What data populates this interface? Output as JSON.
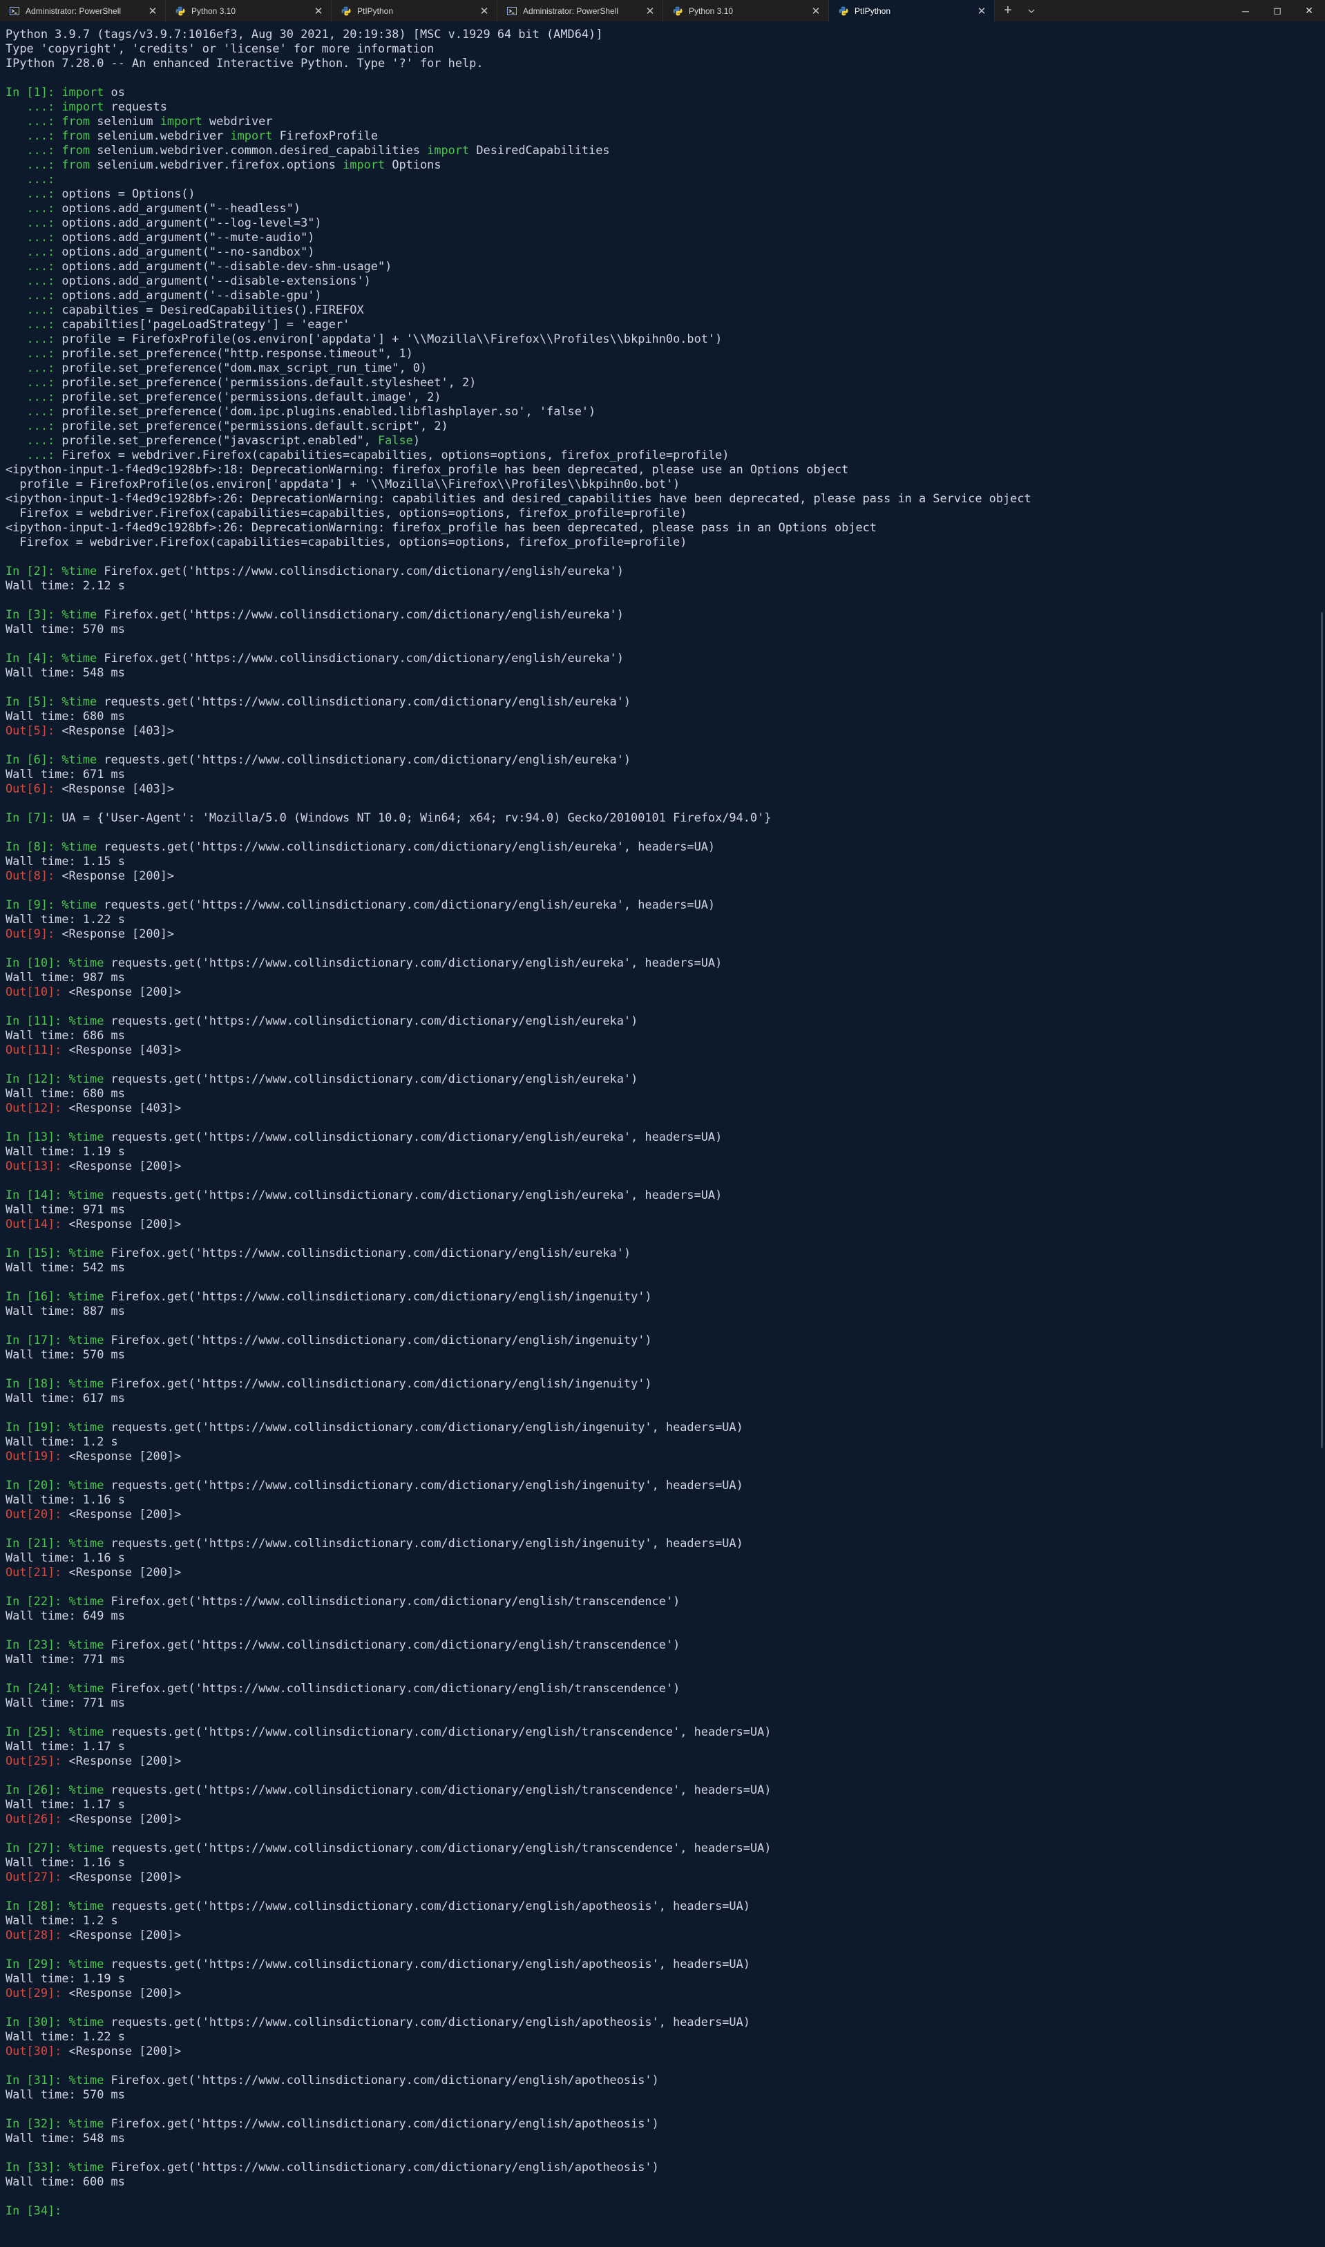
{
  "tabs": [
    {
      "label": "Administrator: PowerShell",
      "icon": "powershell-icon",
      "active": false
    },
    {
      "label": "Python 3.10",
      "icon": "python-icon",
      "active": false
    },
    {
      "label": "PtIPython",
      "icon": "python-icon",
      "active": false
    },
    {
      "label": "Administrator: PowerShell",
      "icon": "powershell-icon",
      "active": false
    },
    {
      "label": "Python 3.10",
      "icon": "python-icon",
      "active": false
    },
    {
      "label": "PtIPython",
      "icon": "python-icon",
      "active": true
    }
  ],
  "tab_controls": {
    "close": "✕",
    "new_tab": "+",
    "dropdown": "chevron-down-icon"
  },
  "window_controls": {
    "minimize": "─",
    "maximize": "◻",
    "close": "✕"
  },
  "colors": {
    "background": "#0c1a2c",
    "text": "#cfd6e0",
    "prompt_in": "#4ec44e",
    "prompt_out": "#d8483f",
    "keyword": "#4ec44e"
  },
  "lines": [
    {
      "text": "Python 3.9.7 (tags/v3.9.7:1016ef3, Aug 30 2021, 20:19:38) [MSC v.1929 64 bit (AMD64)]"
    },
    {
      "text": "Type 'copyright', 'credits' or 'license' for more information"
    },
    {
      "text": "IPython 7.28.0 -- An enhanced Interactive Python. Type '?' for help."
    },
    {
      "text": ""
    },
    {
      "prompt": "In [1]: ",
      "kw": "import",
      "text": " os"
    },
    {
      "cont": "   ...: ",
      "kw": "import",
      "text": " requests"
    },
    {
      "cont": "   ...: ",
      "kw": "from",
      "text": " selenium ",
      "kw2": "import",
      "text2": " webdriver"
    },
    {
      "cont": "   ...: ",
      "kw": "from",
      "text": " selenium.webdriver ",
      "kw2": "import",
      "text2": " FirefoxProfile"
    },
    {
      "cont": "   ...: ",
      "kw": "from",
      "text": " selenium.webdriver.common.desired_capabilities ",
      "kw2": "import",
      "text2": " DesiredCapabilities"
    },
    {
      "cont": "   ...: ",
      "kw": "from",
      "text": " selenium.webdriver.firefox.options ",
      "kw2": "import",
      "text2": " Options"
    },
    {
      "cont": "   ...:",
      "text": ""
    },
    {
      "cont": "   ...: ",
      "text": "options = Options()"
    },
    {
      "cont": "   ...: ",
      "text": "options.add_argument(\"--headless\")"
    },
    {
      "cont": "   ...: ",
      "text": "options.add_argument(\"--log-level=3\")"
    },
    {
      "cont": "   ...: ",
      "text": "options.add_argument(\"--mute-audio\")"
    },
    {
      "cont": "   ...: ",
      "text": "options.add_argument(\"--no-sandbox\")"
    },
    {
      "cont": "   ...: ",
      "text": "options.add_argument(\"--disable-dev-shm-usage\")"
    },
    {
      "cont": "   ...: ",
      "text": "options.add_argument('--disable-extensions')"
    },
    {
      "cont": "   ...: ",
      "text": "options.add_argument('--disable-gpu')"
    },
    {
      "cont": "   ...: ",
      "text": "capabilties = DesiredCapabilities().FIREFOX"
    },
    {
      "cont": "   ...: ",
      "text": "capabilties['pageLoadStrategy'] = 'eager'"
    },
    {
      "cont": "   ...: ",
      "text": "profile = FirefoxProfile(os.environ['appdata'] + '\\\\Mozilla\\\\Firefox\\\\Profiles\\\\bkpihn0o.bot')"
    },
    {
      "cont": "   ...: ",
      "text": "profile.set_preference(\"http.response.timeout\", 1)"
    },
    {
      "cont": "   ...: ",
      "text": "profile.set_preference(\"dom.max_script_run_time\", 0)"
    },
    {
      "cont": "   ...: ",
      "text": "profile.set_preference('permissions.default.stylesheet', 2)"
    },
    {
      "cont": "   ...: ",
      "text": "profile.set_preference('permissions.default.image', 2)"
    },
    {
      "cont": "   ...: ",
      "text": "profile.set_preference('dom.ipc.plugins.enabled.libflashplayer.so', 'false')"
    },
    {
      "cont": "   ...: ",
      "text": "profile.set_preference(\"permissions.default.script\", 2)"
    },
    {
      "cont": "   ...: ",
      "text": "profile.set_preference(\"javascript.enabled\", ",
      "kw2": "False",
      "text2": ")"
    },
    {
      "cont": "   ...: ",
      "text": "Firefox = webdriver.Firefox(capabilities=capabilties, options=options, firefox_profile=profile)"
    },
    {
      "text": "<ipython-input-1-f4ed9c1928bf>:18: DeprecationWarning: firefox_profile has been deprecated, please use an Options object"
    },
    {
      "text": "  profile = FirefoxProfile(os.environ['appdata'] + '\\\\Mozilla\\\\Firefox\\\\Profiles\\\\bkpihn0o.bot')"
    },
    {
      "text": "<ipython-input-1-f4ed9c1928bf>:26: DeprecationWarning: capabilities and desired_capabilities have been deprecated, please pass in a Service object"
    },
    {
      "text": "  Firefox = webdriver.Firefox(capabilities=capabilties, options=options, firefox_profile=profile)"
    },
    {
      "text": "<ipython-input-1-f4ed9c1928bf>:26: DeprecationWarning: firefox_profile has been deprecated, please pass in an Options object"
    },
    {
      "text": "  Firefox = webdriver.Firefox(capabilities=capabilties, options=options, firefox_profile=profile)"
    },
    {
      "text": ""
    },
    {
      "prompt": "In [2]: ",
      "kw": "%time",
      "text": " Firefox.get('https://www.collinsdictionary.com/dictionary/english/eureka')"
    },
    {
      "text": "Wall time: 2.12 s"
    },
    {
      "text": ""
    },
    {
      "prompt": "In [3]: ",
      "kw": "%time",
      "text": " Firefox.get('https://www.collinsdictionary.com/dictionary/english/eureka')"
    },
    {
      "text": "Wall time: 570 ms"
    },
    {
      "text": ""
    },
    {
      "prompt": "In [4]: ",
      "kw": "%time",
      "text": " Firefox.get('https://www.collinsdictionary.com/dictionary/english/eureka')"
    },
    {
      "text": "Wall time: 548 ms"
    },
    {
      "text": ""
    },
    {
      "prompt": "In [5]: ",
      "kw": "%time",
      "text": " requests.get('https://www.collinsdictionary.com/dictionary/english/eureka')"
    },
    {
      "text": "Wall time: 680 ms"
    },
    {
      "out": "Out[5]: ",
      "text": "<Response [403]>"
    },
    {
      "text": ""
    },
    {
      "prompt": "In [6]: ",
      "kw": "%time",
      "text": " requests.get('https://www.collinsdictionary.com/dictionary/english/eureka')"
    },
    {
      "text": "Wall time: 671 ms"
    },
    {
      "out": "Out[6]: ",
      "text": "<Response [403]>"
    },
    {
      "text": ""
    },
    {
      "prompt": "In [7]: ",
      "text": "UA = {'User-Agent': 'Mozilla/5.0 (Windows NT 10.0; Win64; x64; rv:94.0) Gecko/20100101 Firefox/94.0'}"
    },
    {
      "text": ""
    },
    {
      "prompt": "In [8]: ",
      "kw": "%time",
      "text": " requests.get('https://www.collinsdictionary.com/dictionary/english/eureka', headers=UA)"
    },
    {
      "text": "Wall time: 1.15 s"
    },
    {
      "out": "Out[8]: ",
      "text": "<Response [200]>"
    },
    {
      "text": ""
    },
    {
      "prompt": "In [9]: ",
      "kw": "%time",
      "text": " requests.get('https://www.collinsdictionary.com/dictionary/english/eureka', headers=UA)"
    },
    {
      "text": "Wall time: 1.22 s"
    },
    {
      "out": "Out[9]: ",
      "text": "<Response [200]>"
    },
    {
      "text": ""
    },
    {
      "prompt": "In [10]: ",
      "kw": "%time",
      "text": " requests.get('https://www.collinsdictionary.com/dictionary/english/eureka', headers=UA)"
    },
    {
      "text": "Wall time: 987 ms"
    },
    {
      "out": "Out[10]: ",
      "text": "<Response [200]>"
    },
    {
      "text": ""
    },
    {
      "prompt": "In [11]: ",
      "kw": "%time",
      "text": " requests.get('https://www.collinsdictionary.com/dictionary/english/eureka')"
    },
    {
      "text": "Wall time: 686 ms"
    },
    {
      "out": "Out[11]: ",
      "text": "<Response [403]>"
    },
    {
      "text": ""
    },
    {
      "prompt": "In [12]: ",
      "kw": "%time",
      "text": " requests.get('https://www.collinsdictionary.com/dictionary/english/eureka')"
    },
    {
      "text": "Wall time: 680 ms"
    },
    {
      "out": "Out[12]: ",
      "text": "<Response [403]>"
    },
    {
      "text": ""
    },
    {
      "prompt": "In [13]: ",
      "kw": "%time",
      "text": " requests.get('https://www.collinsdictionary.com/dictionary/english/eureka', headers=UA)"
    },
    {
      "text": "Wall time: 1.19 s"
    },
    {
      "out": "Out[13]: ",
      "text": "<Response [200]>"
    },
    {
      "text": ""
    },
    {
      "prompt": "In [14]: ",
      "kw": "%time",
      "text": " requests.get('https://www.collinsdictionary.com/dictionary/english/eureka', headers=UA)"
    },
    {
      "text": "Wall time: 971 ms"
    },
    {
      "out": "Out[14]: ",
      "text": "<Response [200]>"
    },
    {
      "text": ""
    },
    {
      "prompt": "In [15]: ",
      "kw": "%time",
      "text": " Firefox.get('https://www.collinsdictionary.com/dictionary/english/eureka')"
    },
    {
      "text": "Wall time: 542 ms"
    },
    {
      "text": ""
    },
    {
      "prompt": "In [16]: ",
      "kw": "%time",
      "text": " Firefox.get('https://www.collinsdictionary.com/dictionary/english/ingenuity')"
    },
    {
      "text": "Wall time: 887 ms"
    },
    {
      "text": ""
    },
    {
      "prompt": "In [17]: ",
      "kw": "%time",
      "text": " Firefox.get('https://www.collinsdictionary.com/dictionary/english/ingenuity')"
    },
    {
      "text": "Wall time: 570 ms"
    },
    {
      "text": ""
    },
    {
      "prompt": "In [18]: ",
      "kw": "%time",
      "text": " Firefox.get('https://www.collinsdictionary.com/dictionary/english/ingenuity')"
    },
    {
      "text": "Wall time: 617 ms"
    },
    {
      "text": ""
    },
    {
      "prompt": "In [19]: ",
      "kw": "%time",
      "text": " requests.get('https://www.collinsdictionary.com/dictionary/english/ingenuity', headers=UA)"
    },
    {
      "text": "Wall time: 1.2 s"
    },
    {
      "out": "Out[19]: ",
      "text": "<Response [200]>"
    },
    {
      "text": ""
    },
    {
      "prompt": "In [20]: ",
      "kw": "%time",
      "text": " requests.get('https://www.collinsdictionary.com/dictionary/english/ingenuity', headers=UA)"
    },
    {
      "text": "Wall time: 1.16 s"
    },
    {
      "out": "Out[20]: ",
      "text": "<Response [200]>"
    },
    {
      "text": ""
    },
    {
      "prompt": "In [21]: ",
      "kw": "%time",
      "text": " requests.get('https://www.collinsdictionary.com/dictionary/english/ingenuity', headers=UA)"
    },
    {
      "text": "Wall time: 1.16 s"
    },
    {
      "out": "Out[21]: ",
      "text": "<Response [200]>"
    },
    {
      "text": ""
    },
    {
      "prompt": "In [22]: ",
      "kw": "%time",
      "text": " Firefox.get('https://www.collinsdictionary.com/dictionary/english/transcendence')"
    },
    {
      "text": "Wall time: 649 ms"
    },
    {
      "text": ""
    },
    {
      "prompt": "In [23]: ",
      "kw": "%time",
      "text": " Firefox.get('https://www.collinsdictionary.com/dictionary/english/transcendence')"
    },
    {
      "text": "Wall time: 771 ms"
    },
    {
      "text": ""
    },
    {
      "prompt": "In [24]: ",
      "kw": "%time",
      "text": " Firefox.get('https://www.collinsdictionary.com/dictionary/english/transcendence')"
    },
    {
      "text": "Wall time: 771 ms"
    },
    {
      "text": ""
    },
    {
      "prompt": "In [25]: ",
      "kw": "%time",
      "text": " requests.get('https://www.collinsdictionary.com/dictionary/english/transcendence', headers=UA)"
    },
    {
      "text": "Wall time: 1.17 s"
    },
    {
      "out": "Out[25]: ",
      "text": "<Response [200]>"
    },
    {
      "text": ""
    },
    {
      "prompt": "In [26]: ",
      "kw": "%time",
      "text": " requests.get('https://www.collinsdictionary.com/dictionary/english/transcendence', headers=UA)"
    },
    {
      "text": "Wall time: 1.17 s"
    },
    {
      "out": "Out[26]: ",
      "text": "<Response [200]>"
    },
    {
      "text": ""
    },
    {
      "prompt": "In [27]: ",
      "kw": "%time",
      "text": " requests.get('https://www.collinsdictionary.com/dictionary/english/transcendence', headers=UA)"
    },
    {
      "text": "Wall time: 1.16 s"
    },
    {
      "out": "Out[27]: ",
      "text": "<Response [200]>"
    },
    {
      "text": ""
    },
    {
      "prompt": "In [28]: ",
      "kw": "%time",
      "text": " requests.get('https://www.collinsdictionary.com/dictionary/english/apotheosis', headers=UA)"
    },
    {
      "text": "Wall time: 1.2 s"
    },
    {
      "out": "Out[28]: ",
      "text": "<Response [200]>"
    },
    {
      "text": ""
    },
    {
      "prompt": "In [29]: ",
      "kw": "%time",
      "text": " requests.get('https://www.collinsdictionary.com/dictionary/english/apotheosis', headers=UA)"
    },
    {
      "text": "Wall time: 1.19 s"
    },
    {
      "out": "Out[29]: ",
      "text": "<Response [200]>"
    },
    {
      "text": ""
    },
    {
      "prompt": "In [30]: ",
      "kw": "%time",
      "text": " requests.get('https://www.collinsdictionary.com/dictionary/english/apotheosis', headers=UA)"
    },
    {
      "text": "Wall time: 1.22 s"
    },
    {
      "out": "Out[30]: ",
      "text": "<Response [200]>"
    },
    {
      "text": ""
    },
    {
      "prompt": "In [31]: ",
      "kw": "%time",
      "text": " Firefox.get('https://www.collinsdictionary.com/dictionary/english/apotheosis')"
    },
    {
      "text": "Wall time: 570 ms"
    },
    {
      "text": ""
    },
    {
      "prompt": "In [32]: ",
      "kw": "%time",
      "text": " Firefox.get('https://www.collinsdictionary.com/dictionary/english/apotheosis')"
    },
    {
      "text": "Wall time: 548 ms"
    },
    {
      "text": ""
    },
    {
      "prompt": "In [33]: ",
      "kw": "%time",
      "text": " Firefox.get('https://www.collinsdictionary.com/dictionary/english/apotheosis')"
    },
    {
      "text": "Wall time: 600 ms"
    },
    {
      "text": ""
    },
    {
      "prompt": "In [34]: ",
      "text": ""
    }
  ]
}
